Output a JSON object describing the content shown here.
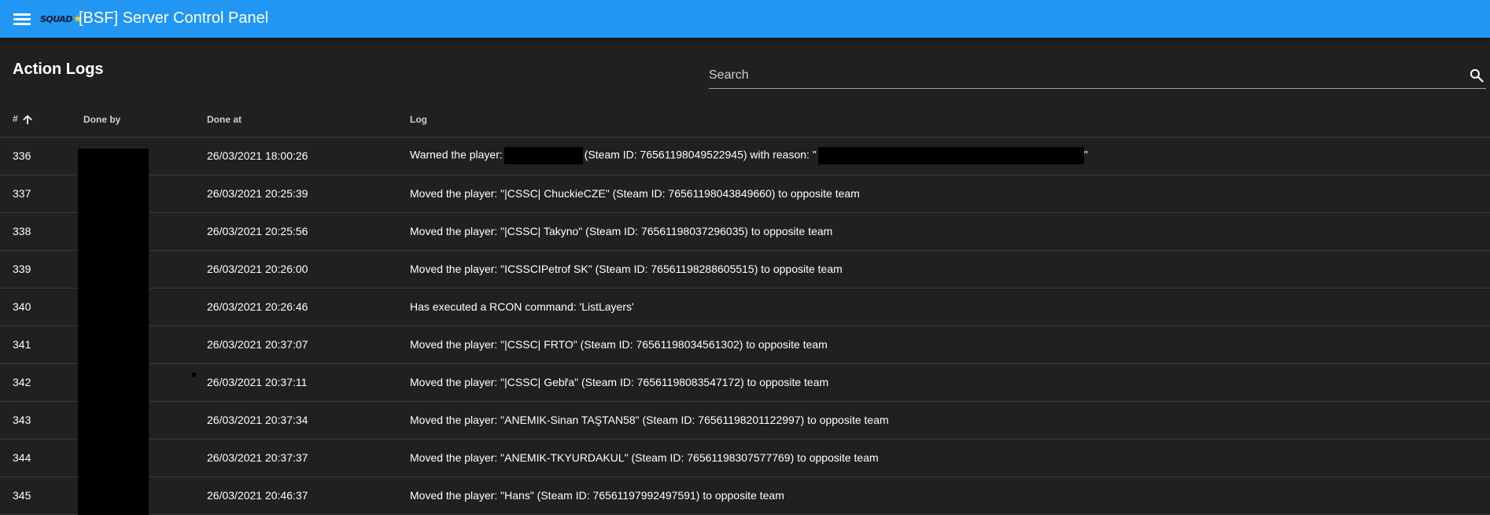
{
  "app": {
    "title": "[BSF] Server Control Panel",
    "logo_text": "SQUAD",
    "accent_color": "#2196f3",
    "background_color": "#202020"
  },
  "page": {
    "title": "Action Logs"
  },
  "search": {
    "placeholder": "Search",
    "value": ""
  },
  "table": {
    "columns": [
      "#",
      "Done by",
      "Done at",
      "Log"
    ],
    "sort": {
      "column": "#",
      "direction": "ascending"
    },
    "rows": [
      {
        "id": "336",
        "done_at": "26/03/2021 18:00:26",
        "log_prefix": "Warned the player:",
        "log_mid": "(Steam ID: 76561198049522945) with reason: \"",
        "log_suffix": "\""
      },
      {
        "id": "337",
        "done_at": "26/03/2021 20:25:39",
        "log": "Moved the player: \"|CSSC| ChuckieCZE\" (Steam ID: 76561198043849660) to opposite team"
      },
      {
        "id": "338",
        "done_at": "26/03/2021 20:25:56",
        "log": "Moved the player: \"|CSSC| Takyno\" (Steam ID: 76561198037296035) to opposite team"
      },
      {
        "id": "339",
        "done_at": "26/03/2021 20:26:00",
        "log": "Moved the player: \"ICSSCIPetrof SK\" (Steam ID: 76561198288605515) to opposite team"
      },
      {
        "id": "340",
        "done_at": "26/03/2021 20:26:46",
        "log": "Has executed a RCON command: 'ListLayers'"
      },
      {
        "id": "341",
        "done_at": "26/03/2021 20:37:07",
        "log": "Moved the player: \"|CSSC| FRTO\" (Steam ID: 76561198034561302) to opposite team"
      },
      {
        "id": "342",
        "done_at": "26/03/2021 20:37:11",
        "log": "Moved the player: \"|CSSC| Gebřa\" (Steam ID: 76561198083547172) to opposite team"
      },
      {
        "id": "343",
        "done_at": "26/03/2021 20:37:34",
        "log": "Moved the player: \"ANEMIK-Sinan TAŞTAN58\" (Steam ID: 76561198201122997) to opposite team"
      },
      {
        "id": "344",
        "done_at": "26/03/2021 20:37:37",
        "log": "Moved the player: \"ANEMIK-TKYURDAKUL\" (Steam ID: 76561198307577769) to opposite team"
      },
      {
        "id": "345",
        "done_at": "26/03/2021 20:46:37",
        "log": "Moved the player: \"Hans\" (Steam ID: 76561197992497591) to opposite team"
      }
    ]
  }
}
